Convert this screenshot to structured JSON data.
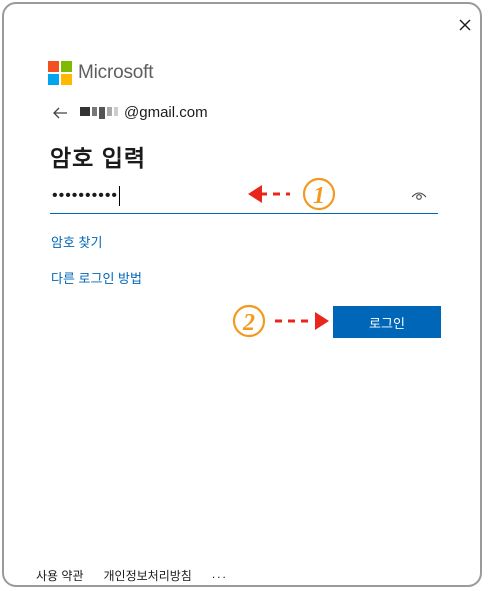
{
  "brand": {
    "name": "Microsoft",
    "colors": {
      "red": "#f25022",
      "green": "#7fba00",
      "blue": "#00a4ef",
      "yellow": "#ffb900"
    }
  },
  "identity": {
    "email_suffix": "@gmail.com"
  },
  "heading": "암호 입력",
  "password": {
    "masked_value": "••••••••••"
  },
  "links": {
    "forgot_password": "암호 찾기",
    "other_ways": "다른 로그인 방법"
  },
  "signin_button": "로그인",
  "footer": {
    "terms": "사용 약관",
    "privacy": "개인정보처리방침",
    "more": "..."
  },
  "annotations": {
    "step1": "1",
    "step2": "2",
    "color": "#e8261b",
    "badge_fill": "#f39a1e"
  },
  "accent_color": "#0067b8"
}
